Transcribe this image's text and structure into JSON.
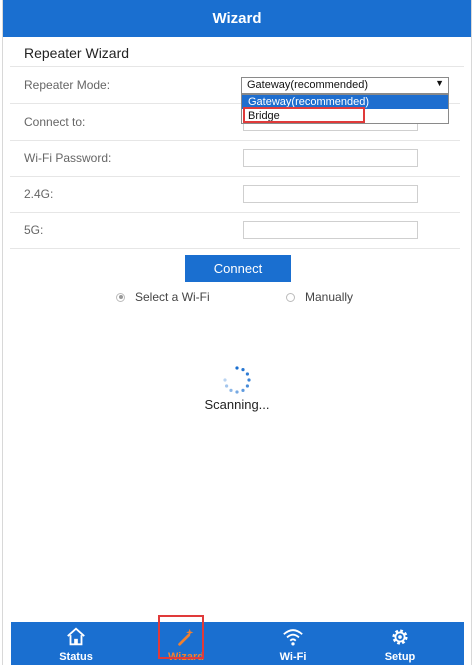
{
  "header": {
    "title": "Wizard"
  },
  "section": {
    "title": "Repeater Wizard"
  },
  "form": {
    "mode_label": "Repeater Mode:",
    "mode_selected": "Gateway(recommended)",
    "mode_options": [
      "Gateway(recommended)",
      "Bridge"
    ],
    "connect_to_label": "Connect to:",
    "password_label": "Wi-Fi Password:",
    "band24_label": "2.4G:",
    "band5_label": "5G:"
  },
  "actions": {
    "connect_label": "Connect"
  },
  "radios": {
    "select_wifi_label": "Select a Wi-Fi",
    "manually_label": "Manually",
    "selected": "Select a Wi-Fi"
  },
  "status": {
    "scanning_text": "Scanning..."
  },
  "tabbar": {
    "tabs": [
      {
        "label": "Status",
        "icon": "home-icon"
      },
      {
        "label": "Wizard",
        "icon": "wand-icon"
      },
      {
        "label": "Wi-Fi",
        "icon": "wifi-icon"
      },
      {
        "label": "Setup",
        "icon": "gear-icon"
      }
    ],
    "active": "Wizard",
    "active_color": "#f08030"
  },
  "colors": {
    "primary": "#1a6fd0",
    "highlight": "#e03a3a"
  }
}
